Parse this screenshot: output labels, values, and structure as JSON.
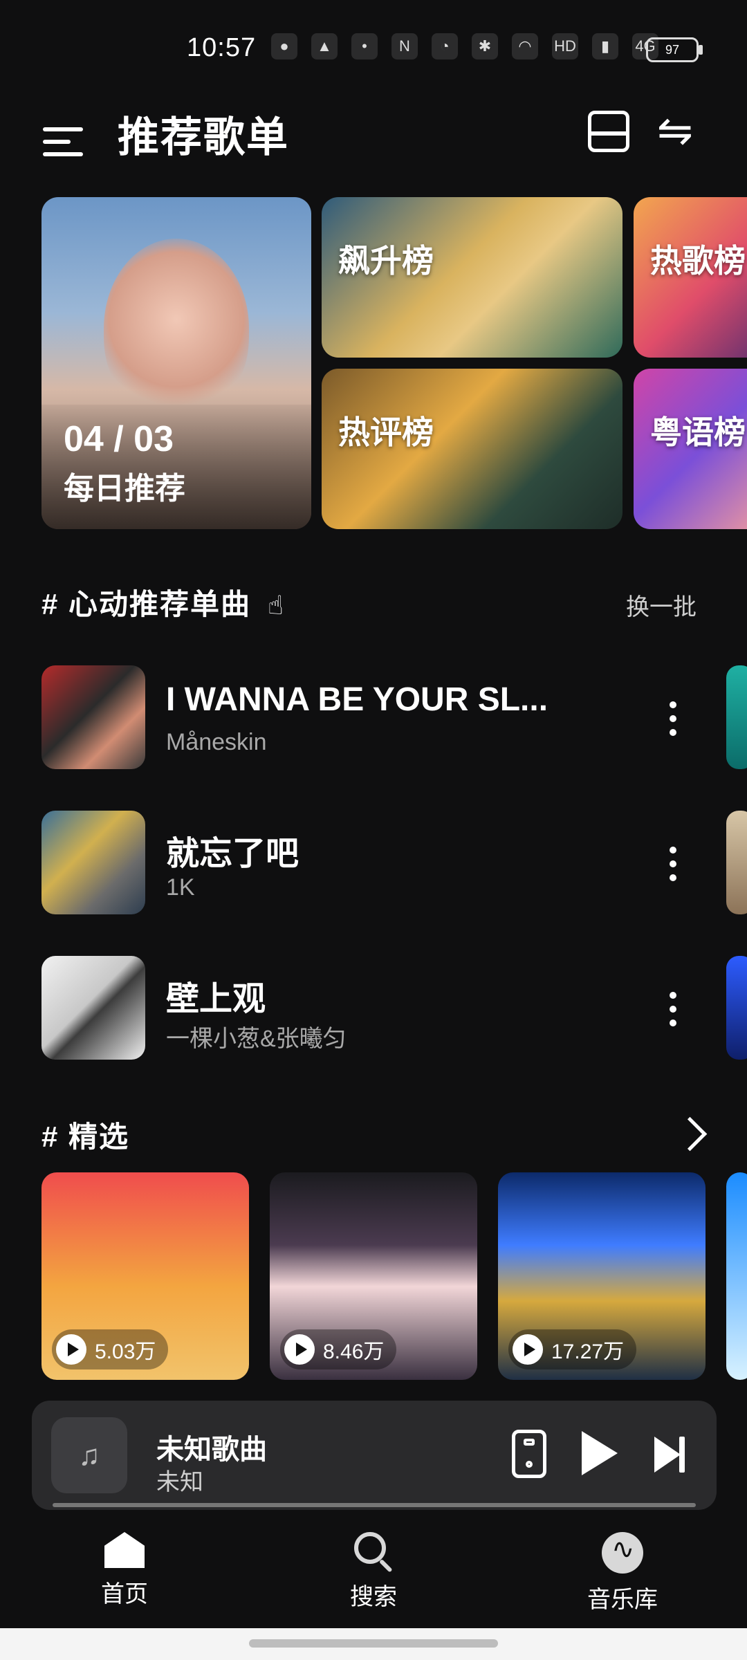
{
  "status_bar": {
    "time": "10:57",
    "icons": [
      "wechat-icon",
      "app-bird-icon",
      "dot-icon",
      "nfc-icon",
      "alarm-icon",
      "bluetooth-icon",
      "wifi-icon",
      "hd-icon",
      "signal-icon",
      "signal-4g-icon"
    ],
    "battery": "97"
  },
  "header": {
    "title": "推荐歌单"
  },
  "top_cards": {
    "daily": {
      "date": "04 / 03",
      "label": "每日推荐"
    },
    "ranks": [
      {
        "label": "飙升榜"
      },
      {
        "label": "热评榜"
      },
      {
        "label": "热歌榜"
      },
      {
        "label": "粤语榜"
      }
    ]
  },
  "section_favorites": {
    "title": "# 心动推荐单曲",
    "action": "换一批",
    "songs": [
      {
        "title": "I WANNA BE YOUR SL...",
        "artist": "Måneskin"
      },
      {
        "title": "就忘了吧",
        "artist": "1K"
      },
      {
        "title": "壁上观",
        "artist": "一棵小葱&张曦匀"
      }
    ]
  },
  "section_picks": {
    "title": "# 精选",
    "items": [
      {
        "count": "5.03万"
      },
      {
        "count": "8.46万"
      },
      {
        "count": "17.27万"
      }
    ]
  },
  "mini_player": {
    "title": "未知歌曲",
    "artist": "未知",
    "progress": 0
  },
  "bottom_nav": {
    "items": [
      {
        "label": "首页"
      },
      {
        "label": "搜索"
      },
      {
        "label": "音乐库"
      }
    ]
  },
  "colors": {
    "background": "#0f0f10",
    "surface": "#2a2a2c",
    "text": "#ffffff",
    "muted": "#a9a9a9"
  }
}
